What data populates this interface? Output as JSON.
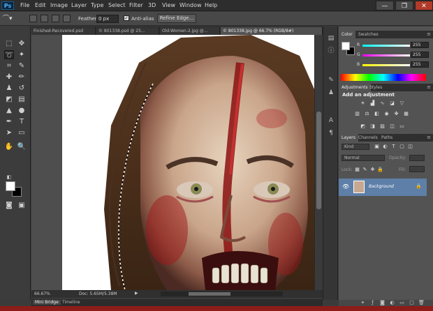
{
  "app": {
    "logo": "Ps"
  },
  "menu": [
    "File",
    "Edit",
    "Image",
    "Layer",
    "Type",
    "Select",
    "Filter",
    "3D",
    "View",
    "Window",
    "Help"
  ],
  "window_controls": {
    "minimize": "—",
    "restore": "❐",
    "close": "✕"
  },
  "options": {
    "feather_label": "Feather:",
    "feather_value": "0 px",
    "antialias_label": "Anti-alias",
    "antialias_checked": true,
    "refine_edge": "Refine Edge..."
  },
  "doc_tabs": [
    {
      "label": "Finished-Recovered.psd",
      "active": false
    },
    {
      "label": "© 801338.psd @ 25...",
      "active": false
    },
    {
      "label": "Old-Women-2.jpg @...",
      "active": false
    },
    {
      "label": "© 801338.jpg @ 66.7% (RGB/8#)",
      "active": true
    }
  ],
  "status": {
    "zoom": "66.67%",
    "doc": "Doc: 5.65M/5.38M"
  },
  "bottom_tabs": [
    "Mini Bridge",
    "Timeline"
  ],
  "color_panel": {
    "tabs": [
      "Color",
      "Swatches"
    ],
    "channels": [
      {
        "name": "R",
        "value": "255"
      },
      {
        "name": "G",
        "value": "255"
      },
      {
        "name": "B",
        "value": "255"
      }
    ]
  },
  "adjustments_panel": {
    "tabs": [
      "Adjustments",
      "Styles"
    ],
    "title": "Add an adjustment"
  },
  "layers_panel": {
    "tabs": [
      "Layers",
      "Channels",
      "Paths"
    ],
    "filter": "Kind",
    "blend": "Normal",
    "opacity_label": "Opacity:",
    "lock_label": "Lock:",
    "fill_label": "Fill:",
    "layers": [
      {
        "name": "Background",
        "visible": true,
        "locked": true
      }
    ]
  },
  "colors": {
    "accent_selection": "#5d7fa8",
    "foreground": "#ffffff",
    "background": "#000000"
  }
}
